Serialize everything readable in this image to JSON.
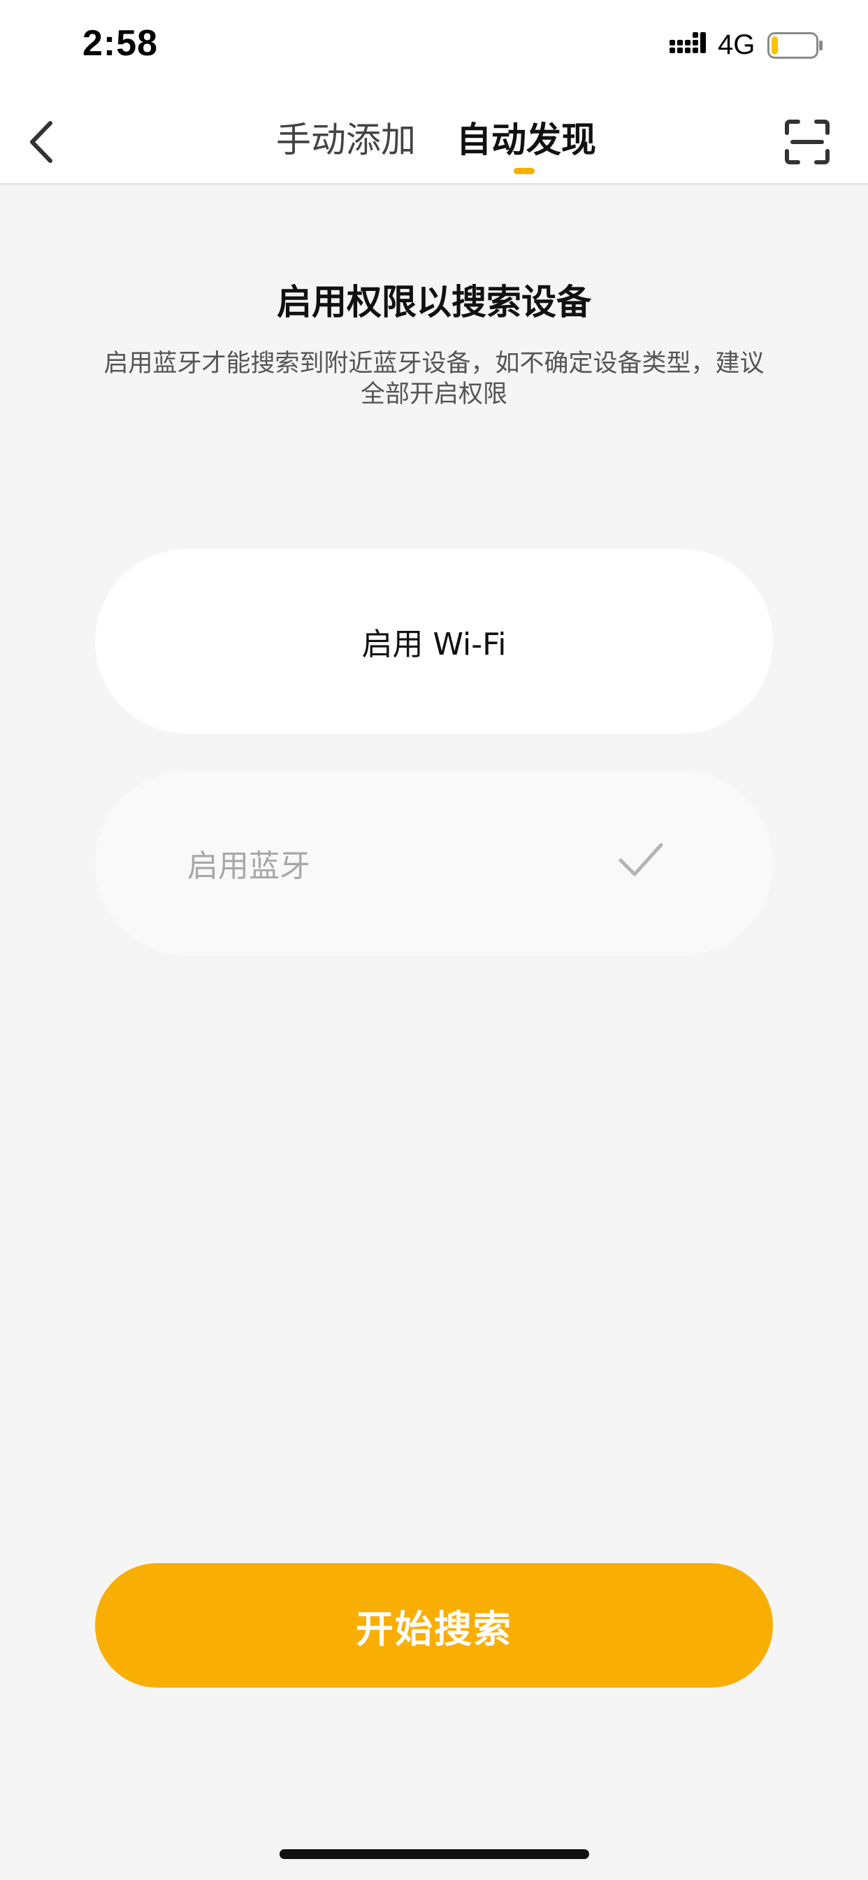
{
  "status_bar": {
    "time": "2:58",
    "network": "4G",
    "battery_level": 0.15
  },
  "header": {
    "tabs": [
      {
        "label": "手动添加",
        "active": false
      },
      {
        "label": "自动发现",
        "active": true
      }
    ],
    "accent_color": "#F9AE04"
  },
  "main": {
    "title": "启用权限以搜索设备",
    "description": "启用蓝牙才能搜索到附近蓝牙设备，如不确定设备类型，建议全部开启权限",
    "permissions": [
      {
        "label": "启用 Wi-Fi",
        "enabled": false
      },
      {
        "label": "启用蓝牙",
        "enabled": true,
        "icon": "check-icon"
      }
    ]
  },
  "footer": {
    "start_button_label": "开始搜索"
  }
}
